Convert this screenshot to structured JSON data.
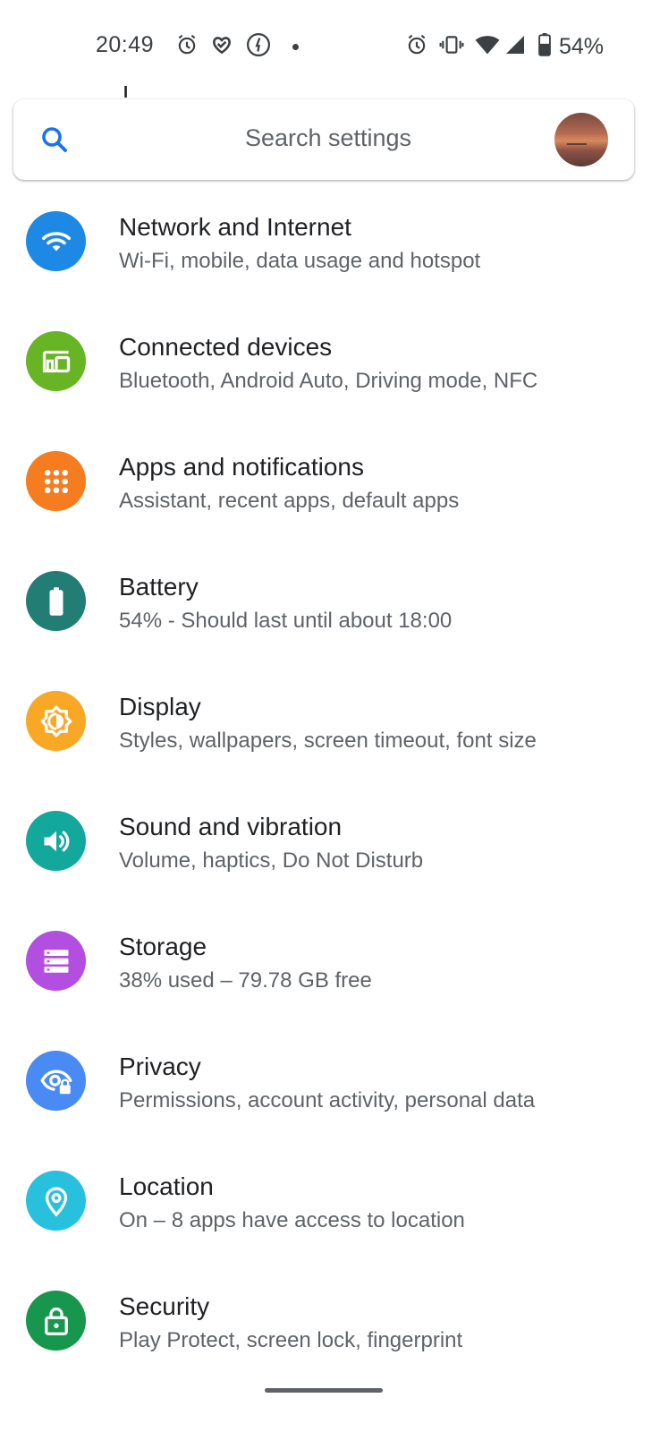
{
  "status_bar": {
    "time": "20:49",
    "battery_percent": "54%",
    "left_icons": [
      "alarm-icon",
      "heart-check-icon",
      "timer-app-icon",
      "notification-dot-icon"
    ],
    "right_icons": [
      "alarm-icon",
      "vibrate-icon",
      "wifi-icon",
      "cell-signal-icon",
      "battery-icon"
    ]
  },
  "search": {
    "placeholder": "Search settings",
    "icon": "search-icon",
    "accent_color": "#1a73e8"
  },
  "settings": {
    "items": [
      {
        "title": "Network and Internet",
        "summary": "Wi-Fi, mobile, data usage and hotspot",
        "icon": "wifi-icon",
        "color": "#1e88e5"
      },
      {
        "title": "Connected devices",
        "summary": "Bluetooth, Android Auto, Driving mode, NFC",
        "icon": "devices-icon",
        "color": "#67b524"
      },
      {
        "title": "Apps and notifications",
        "summary": "Assistant, recent apps, default apps",
        "icon": "apps-grid-icon",
        "color": "#f57c1f"
      },
      {
        "title": "Battery",
        "summary": "54% - Should last until about 18:00",
        "icon": "battery-icon",
        "color": "#227d74"
      },
      {
        "title": "Display",
        "summary": "Styles, wallpapers, screen timeout, font size",
        "icon": "brightness-icon",
        "color": "#f9a825"
      },
      {
        "title": "Sound and vibration",
        "summary": "Volume, haptics, Do Not Disturb",
        "icon": "volume-icon",
        "color": "#12a89c"
      },
      {
        "title": "Storage",
        "summary": "38% used – 79.78 GB free",
        "icon": "storage-icon",
        "color": "#b24fe0"
      },
      {
        "title": "Privacy",
        "summary": "Permissions, account activity, personal data",
        "icon": "privacy-eye-lock-icon",
        "color": "#4a8af4"
      },
      {
        "title": "Location",
        "summary": "On – 8 apps have access to location",
        "icon": "location-pin-icon",
        "color": "#27c1dd"
      },
      {
        "title": "Security",
        "summary": "Play Protect, screen lock, fingerprint",
        "icon": "lock-icon",
        "color": "#17964d"
      }
    ]
  }
}
